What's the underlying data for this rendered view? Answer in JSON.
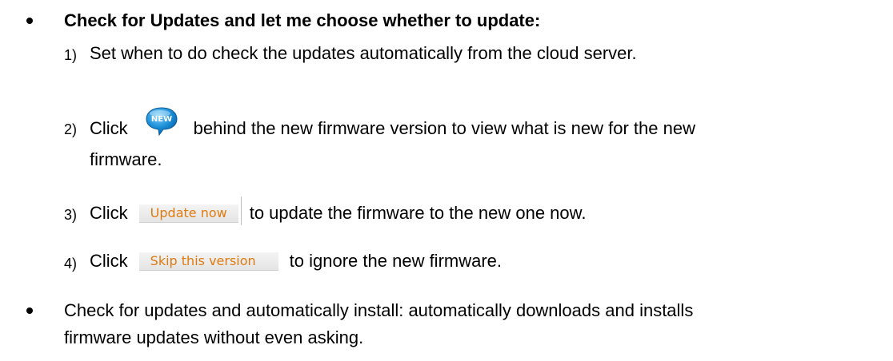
{
  "section1": {
    "heading": "Check for Updates and let me choose whether to update:",
    "steps": [
      {
        "num": "1)",
        "text": "Set when to do check the updates automatically from the cloud server."
      },
      {
        "num": "2)",
        "before": "Click",
        "icon": "new-badge-icon",
        "after": "behind the new firmware version to view what is new for the new",
        "continued": "firmware."
      },
      {
        "num": "3)",
        "before": "Click",
        "button": "Update now",
        "after": "to update the firmware to the new one now."
      },
      {
        "num": "4)",
        "before": "Click",
        "button": "Skip this version",
        "after": "to ignore the new firmware."
      }
    ]
  },
  "section2": {
    "line1": "Check for updates and automatically install: automatically downloads and installs",
    "line2": "firmware updates without even asking."
  },
  "badge_label": "NEW",
  "colors": {
    "button_text": "#e07a10",
    "badge": "#1a8ed6"
  }
}
